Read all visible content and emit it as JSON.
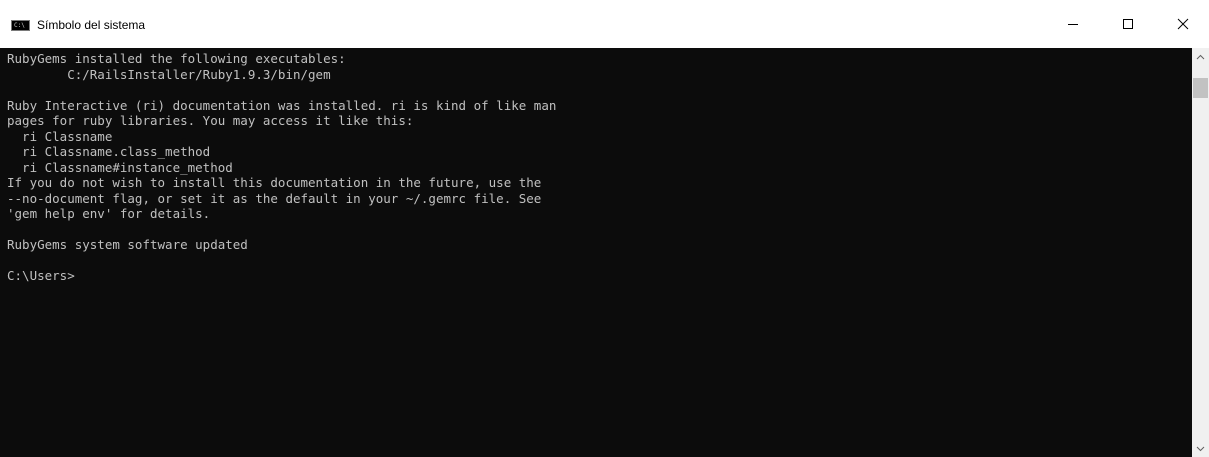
{
  "window": {
    "title": "Símbolo del sistema",
    "icon": "cmd-icon",
    "icon_label": "C:\\",
    "controls": {
      "minimize_icon": "minimize-icon",
      "maximize_icon": "maximize-icon",
      "close_icon": "close-icon"
    }
  },
  "console": {
    "lines": [
      "RubyGems installed the following executables:",
      "        C:/RailsInstaller/Ruby1.9.3/bin/gem",
      "",
      "Ruby Interactive (ri) documentation was installed. ri is kind of like man",
      "pages for ruby libraries. You may access it like this:",
      "  ri Classname",
      "  ri Classname.class_method",
      "  ri Classname#instance_method",
      "If you do not wish to install this documentation in the future, use the",
      "--no-document flag, or set it as the default in your ~/.gemrc file. See",
      "'gem help env' for details.",
      "",
      "RubyGems system software updated",
      "",
      "C:\\Users>"
    ]
  },
  "scrollbar": {
    "up_icon": "scroll-up-arrow-icon",
    "down_icon": "scroll-down-arrow-icon"
  },
  "colors": {
    "console_background": "#0c0c0c",
    "console_text": "#c0c0c0",
    "titlebar_background": "#ffffff"
  }
}
